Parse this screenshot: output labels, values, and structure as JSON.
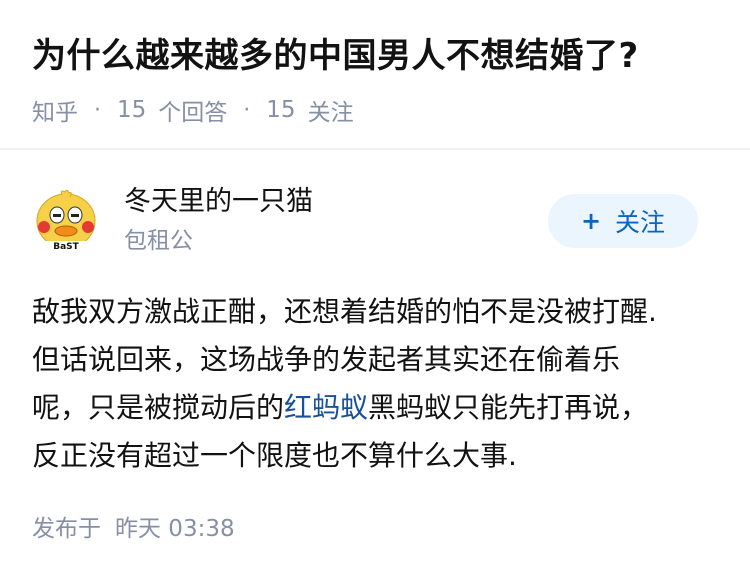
{
  "question": {
    "title": "为什么越来越多的中国男人不想结婚了?",
    "source": "知乎",
    "answers_count": "15",
    "answers_label": "个回答",
    "followers_count": "15",
    "followers_label": "关注",
    "separator": "·"
  },
  "answer": {
    "author": {
      "name": "冬天里的一只猫",
      "bio": "包租公",
      "avatar_icon": "cartoon-chick-avatar",
      "follow_icon": "plus-icon",
      "follow_label": "关注"
    },
    "content_lines": [
      "敌我双方激战正酣，还想着结婚的怕不是没被打醒.",
      "但话说回来，这场战争的发起者其实还在偷着乐",
      "呢，只是被搅动后的",
      "红蚂蚁",
      "黑蚂蚁只能先打再说，",
      "反正没有超过一个限度也不算什么大事."
    ],
    "publish_label": "发布于",
    "publish_time": "昨天 03:38"
  },
  "colors": {
    "text_primary": "#121212",
    "text_secondary": "#8590a6",
    "link": "#175199",
    "brand_blue": "#0a66c2",
    "follow_bg": "#ebf5fd"
  }
}
